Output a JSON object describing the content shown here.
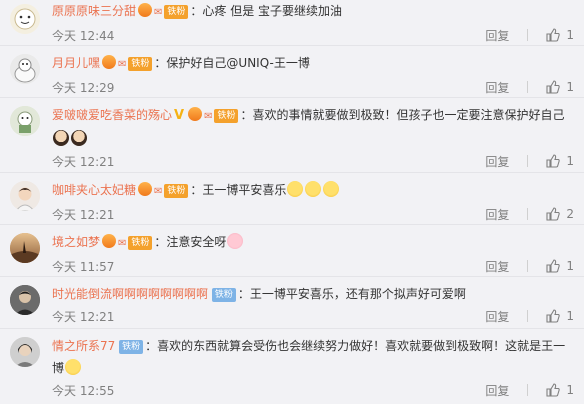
{
  "reply_label": "回复",
  "comments": [
    {
      "user": "原原原味三分甜",
      "badge": "铁粉",
      "badge_color": "orange",
      "text": "：心疼 但是 宝子要继续加油",
      "time": "今天 12:44",
      "likes": "1"
    },
    {
      "user": "月月儿嘿",
      "badge": "铁粉",
      "badge_color": "orange",
      "text": "：保护好自己@UNIQ-王一博",
      "time": "今天 12:29",
      "likes": "1"
    },
    {
      "user": "爱啵啵爱吃香菜的殇心",
      "verified_mark": "V",
      "badge": "铁粉",
      "badge_color": "orange",
      "text": "：喜欢的事情就要做到极致！但孩子也一定要注意保护好自己",
      "time": "今天 12:21",
      "likes": "1"
    },
    {
      "user": "咖啡夹心太妃糖",
      "badge": "铁粉",
      "badge_color": "orange",
      "text": "：王一博平安喜乐",
      "time": "今天 12:21",
      "likes": "2"
    },
    {
      "user": "境之如梦",
      "badge": "铁粉",
      "badge_color": "orange",
      "text": "：注意安全呀",
      "time": "今天 11:57",
      "likes": "1"
    },
    {
      "user": "时光能倒流啊啊啊啊啊啊啊啊",
      "badge": "铁粉",
      "badge_color": "blue",
      "text": "：王一博平安喜乐，还有那个拟声好可爱啊",
      "time": "今天 12:21",
      "likes": "1"
    },
    {
      "user": "情之所系77",
      "badge": "铁粉",
      "badge_color": "blue",
      "text": "：喜欢的东西就算会受伤也会继续努力做好！喜欢就要做到极致啊！这就是王一博",
      "time": "今天 12:55",
      "likes": "1"
    }
  ]
}
